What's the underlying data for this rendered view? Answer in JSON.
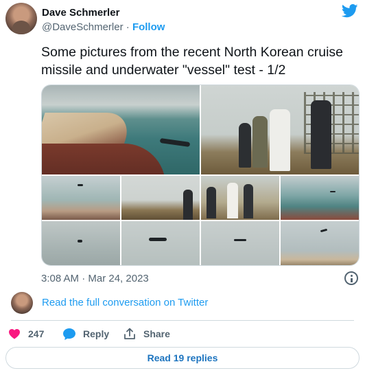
{
  "author": {
    "name": "Dave Schmerler",
    "handle": "@DaveSchmerler",
    "separator": "·",
    "follow_label": "Follow"
  },
  "tweet": {
    "text": "Some pictures from the recent North Korean cruise missile and underwater \"vessel\" test - 1/2",
    "timestamp": "3:08 AM · Mar 24, 2023"
  },
  "conversation_link": "Read the full conversation on Twitter",
  "actions": {
    "like_count": "247",
    "reply_label": "Reply",
    "share_label": "Share"
  },
  "replies_button": "Read 19 replies",
  "colors": {
    "brand": "#1d9bf0",
    "like": "#f91880",
    "muted": "#536471"
  },
  "icons": [
    "twitter-bird-icon",
    "info-icon",
    "heart-icon",
    "reply-bubble-icon",
    "share-icon"
  ]
}
